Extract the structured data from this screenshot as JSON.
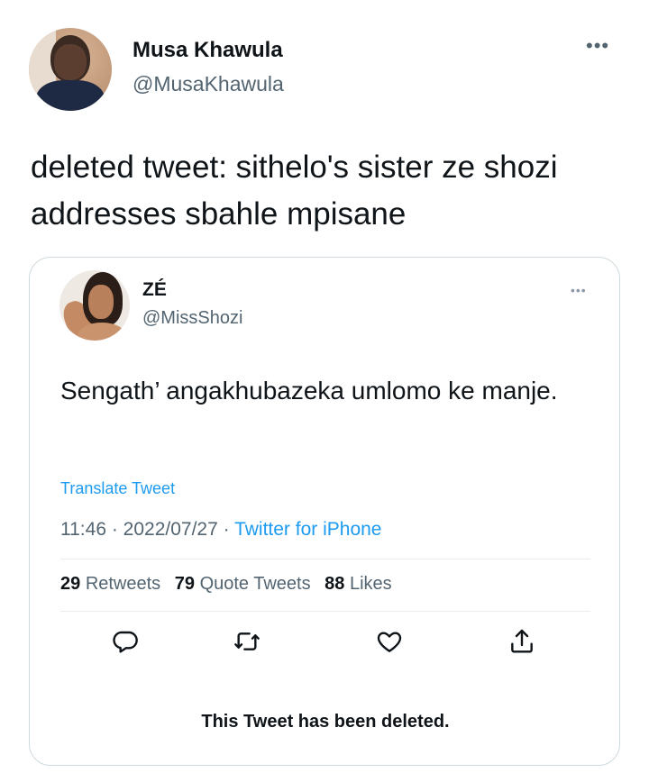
{
  "tweet": {
    "author_name": "Musa Khawula",
    "author_handle": "@MusaKhawula",
    "more_label": "•••",
    "text": "deleted tweet: sithelo's sister ze shozi addresses sbahle mpisane"
  },
  "quote": {
    "author_name": "ZÉ",
    "author_handle": "@MissShozi",
    "more_label": "•••",
    "text": "Sengath’ angakhubazeka umlomo ke manje.",
    "translate_label": "Translate Tweet",
    "time": "11:46",
    "date": "2022/07/27",
    "source": "Twitter for iPhone",
    "stats": {
      "retweets_count": "29",
      "retweets_label": "Retweets",
      "quotes_count": "79",
      "quotes_label": "Quote Tweets",
      "likes_count": "88",
      "likes_label": "Likes"
    },
    "actions": [
      "reply-icon",
      "retweet-icon",
      "like-icon",
      "share-icon"
    ],
    "deleted_notice": "This Tweet has been deleted."
  },
  "colors": {
    "accent": "#1d9bf0",
    "secondary_text": "#536471",
    "primary_text": "#0f1419",
    "border": "#cfd9de"
  }
}
